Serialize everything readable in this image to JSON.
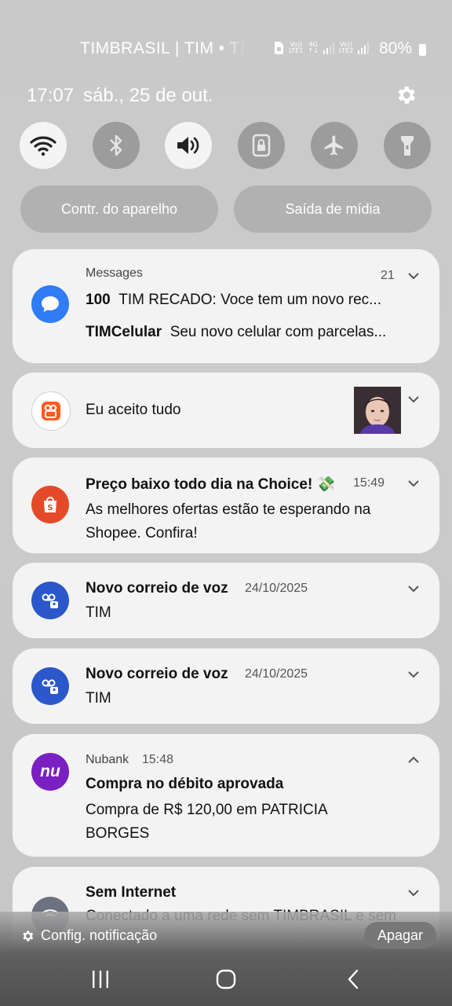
{
  "status_bar": {
    "carrier": "TIMBRASIL | TIM • TIM",
    "sim1": {
      "top": "Vo))",
      "bottom": "LTE1"
    },
    "net": "4G",
    "sim2": {
      "top": "Vo))",
      "bottom": "LTE2"
    },
    "battery": "80%"
  },
  "header": {
    "time": "17:07",
    "date": "sáb., 25 de out."
  },
  "quick_toggles": [
    {
      "icon": "wifi-icon",
      "state": "on"
    },
    {
      "icon": "bluetooth-icon",
      "state": "off"
    },
    {
      "icon": "sound-icon",
      "state": "on"
    },
    {
      "icon": "rotation-lock-icon",
      "state": "off"
    },
    {
      "icon": "airplane-icon",
      "state": "off"
    },
    {
      "icon": "flashlight-icon",
      "state": "off"
    }
  ],
  "pills": {
    "device_control": "Contr. do aparelho",
    "media_output": "Saída de mídia"
  },
  "notifications": {
    "messages": {
      "app": "Messages",
      "count": "21",
      "line1_sender": "100",
      "line1_text": "TIM RECADO: Voce tem um novo rec...",
      "line2_sender": "TIMCelular",
      "line2_text": "Seu novo celular com parcelas..."
    },
    "kwai": {
      "text": "Eu aceito tudo"
    },
    "shopee": {
      "title": "Preço baixo todo dia na Choice! 💸",
      "time": "15:49",
      "body": "As melhores ofertas estão te esperando na Shopee. Confira!"
    },
    "voicemail1": {
      "title": "Novo correio de voz",
      "date": "24/10/2025",
      "body": "TIM"
    },
    "voicemail2": {
      "title": "Novo correio de voz",
      "date": "24/10/2025",
      "body": "TIM"
    },
    "nubank": {
      "app": "Nubank",
      "time": "15:48",
      "icon_text": "nu",
      "title": "Compra no débito aprovada",
      "body": "Compra de R$ 120,00 em PATRICIA BORGES"
    },
    "no_internet": {
      "title": "Sem Internet",
      "body": "Conectado a uma rede sem TIMBRASIL e sem"
    }
  },
  "footer": {
    "settings_label": "Config. notificação",
    "clear_label": "Apagar"
  },
  "colors": {
    "messages": "#2f7cf6",
    "shopee": "#e44a2a",
    "voicemail": "#2a57c9",
    "nubank": "#7a1fc2",
    "kwai": "#ff5a1f"
  }
}
